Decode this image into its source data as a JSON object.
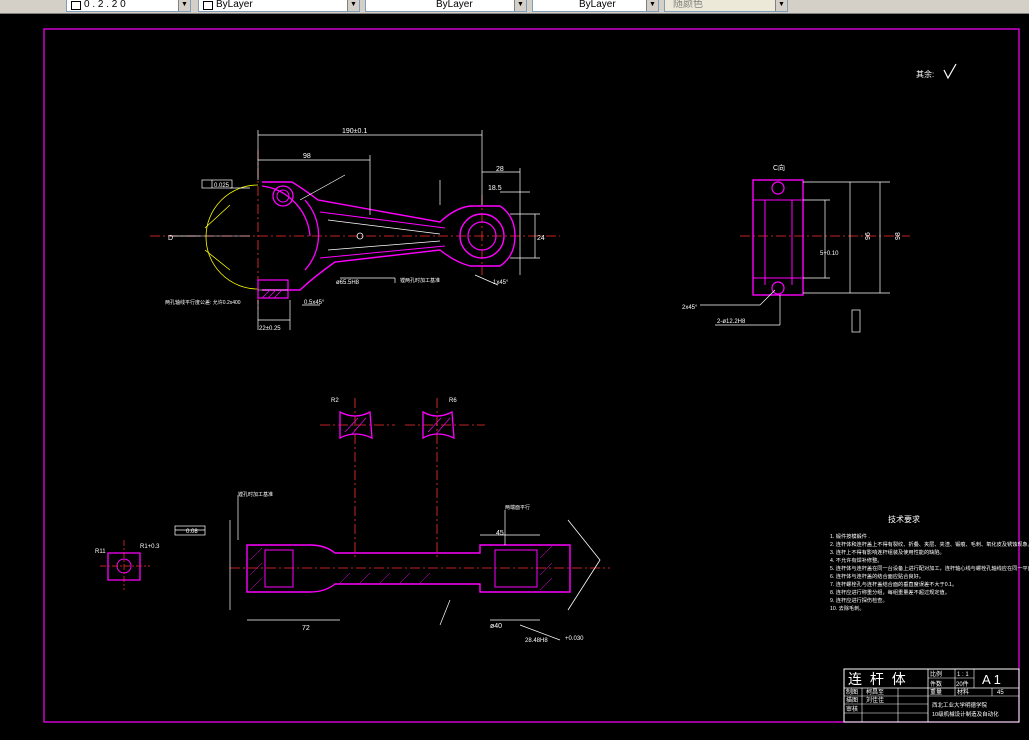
{
  "toolbar": {
    "combo1": "0 . 2 . 2 0",
    "combo2": "ByLayer",
    "combo3": "ByLayer",
    "combo4": "ByLayer",
    "combo5": "随颜色"
  },
  "drawing": {
    "top_right_mark": "其余:",
    "section_c_label": "C向",
    "tech_title": "技术要求",
    "tech_items": [
      "1. 锻件按模锻件 .",
      "2. 连杆体和连杆盖上不得有裂纹、折叠、夹层、夹渣、锻痕、毛刺、氧化皮及锈蚀现象。",
      "3. 连杆上不得有影响连杆组装及使用性能的缺陷。",
      "4. 不允许有焊补修整。",
      "5. 连杆体与连杆盖在同一台设备上进行配对加工，连杆轴心线与螺栓孔轴线应在同一平面内。",
      "6. 连杆体与连杆盖的结合面应贴合良好。",
      "7. 连杆螺栓孔与连杆盖结合面的垂直度误差不大于0.1。",
      "8. 连杆应进行称重分组，每组重量差不超过规定值。",
      "9. 连杆应进行探伤检查。",
      "10. 去除毛刺。"
    ],
    "title_block": {
      "part_name": "连 杆 体",
      "scale_label": "比例",
      "scale": "1 : 1",
      "qty_label": "件数",
      "qty": "20件",
      "sheet": "A 1",
      "material_label": "材料",
      "material": "45",
      "weight_label": "重量",
      "drawn_label": "制图",
      "drawn_by": "柯昌至",
      "checked_label": "描图",
      "checked_by": "刘佳佳",
      "review_label": "审核",
      "school": "西北工业大学明德学院",
      "dept": "10级机械设计制造及自动化"
    },
    "dims": {
      "d190": "190±0.1",
      "d98": "98",
      "d28": "28",
      "d185": "18.5",
      "d24": "24",
      "d36": "36",
      "d0025": "0.025",
      "d02": "0.02",
      "r2": "R2",
      "r6": "R6",
      "d72": "72",
      "d45": "45",
      "d40": "ø40",
      "d008": "0.08",
      "r11": "R11",
      "d2848": "28.48H8",
      "d0030": "+0.030",
      "d96": "96",
      "d98b": "98",
      "dnote1": "2-ø12.2H8",
      "dnote2": "2x45°",
      "d1x45": "1x45°"
    }
  }
}
